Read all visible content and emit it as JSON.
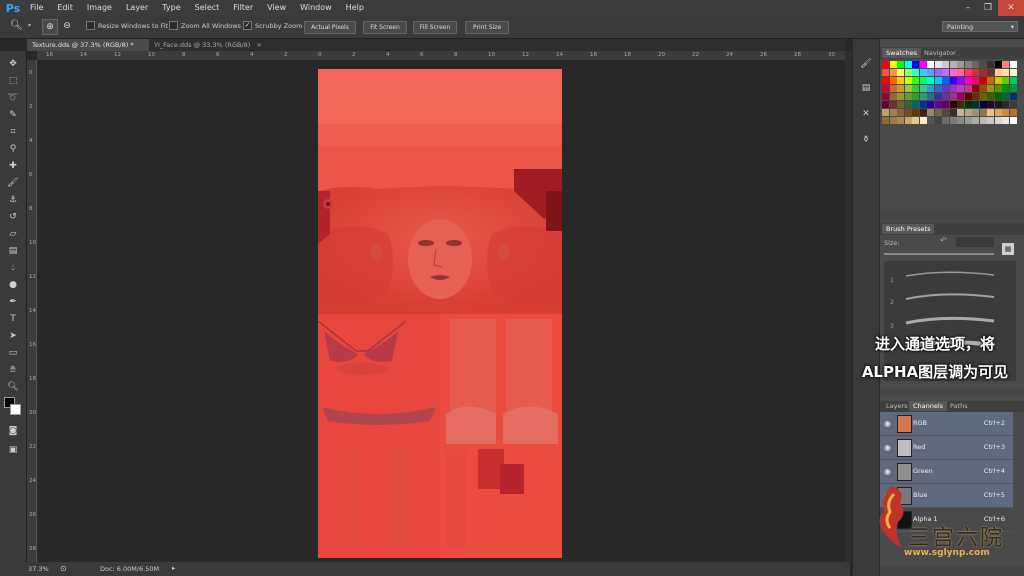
{
  "app": {
    "logo": "Ps"
  },
  "menu": [
    "File",
    "Edit",
    "Image",
    "Layer",
    "Type",
    "Select",
    "Filter",
    "View",
    "Window",
    "Help"
  ],
  "window_controls": {
    "minimize": "–",
    "restore": "❐",
    "close": "✕"
  },
  "options_bar": {
    "resize_windows": "Resize Windows to Fit",
    "zoom_all": "Zoom All Windows",
    "scrubby_zoom": "Scrubby Zoom",
    "actual_pixels": "Actual Pixels",
    "fit_screen": "Fit Screen",
    "fill_screen": "Fill Screen",
    "print_size": "Print Size",
    "workspace": "Painting"
  },
  "tabs": [
    {
      "label": "Texture.dds @ 37.3% (RGB/8) *",
      "close": "×"
    },
    {
      "label": "YI_Face.dds @ 33.3% (RGB/8)",
      "close": "×"
    }
  ],
  "ruler_h": [
    "16",
    "14",
    "12",
    "10",
    "8",
    "6",
    "4",
    "2",
    "0",
    "2",
    "4",
    "6",
    "8",
    "10",
    "12",
    "14",
    "16",
    "18",
    "20",
    "22",
    "24",
    "26",
    "28",
    "30"
  ],
  "ruler_v": [
    "0",
    "2",
    "4",
    "6",
    "8",
    "10",
    "12",
    "14",
    "16",
    "18",
    "20",
    "22",
    "24",
    "26",
    "28"
  ],
  "status": {
    "zoom": "37.3%",
    "doc": "Doc: 6.00M/6.50M"
  },
  "panels": {
    "swatches_tab": "Swatches",
    "navigator_tab": "Navigator",
    "brush_presets_title": "Brush Presets",
    "size_label": "Size:",
    "brush_numbers": [
      "1",
      "2",
      "3",
      "4"
    ],
    "layers_tab": "Layers",
    "channels_tab": "Channels",
    "paths_tab": "Paths"
  },
  "channels": [
    {
      "name": "RGB",
      "shortcut": "Ctrl+2"
    },
    {
      "name": "Red",
      "shortcut": "Ctrl+3"
    },
    {
      "name": "Green",
      "shortcut": "Ctrl+4"
    },
    {
      "name": "Blue",
      "shortcut": "Ctrl+5"
    },
    {
      "name": "Alpha 1",
      "shortcut": "Ctrl+6"
    }
  ],
  "overlay_caption": {
    "line1": "进入通道选项，将",
    "line2": "ALPHA图层调为可见"
  },
  "watermark": {
    "text": "三宫六院",
    "url": "www.sglynp.com"
  },
  "colors": {
    "accent": "#38a6ff",
    "canvas_red": "#ef4a3e",
    "selected_channel": "#5f6a7e"
  }
}
